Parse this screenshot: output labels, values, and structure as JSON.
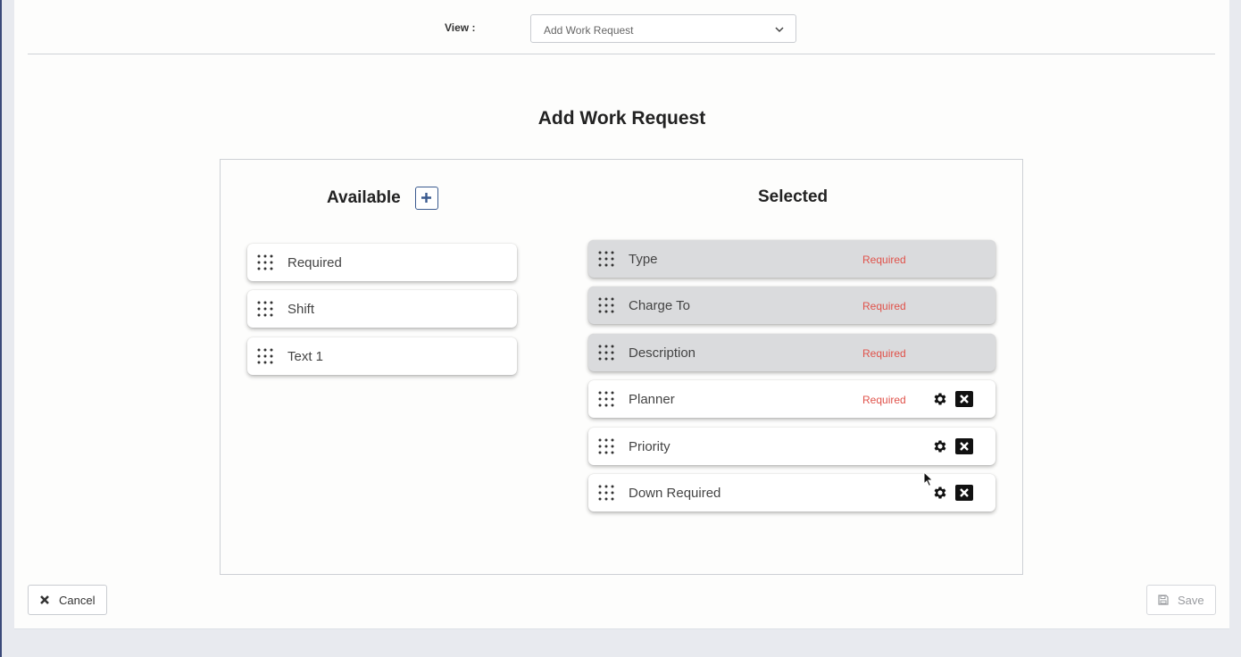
{
  "header": {
    "view_label": "View :",
    "view_select": {
      "value": "Add Work Request",
      "icon": "chevron-down-icon"
    }
  },
  "main": {
    "title": "Add Work Request",
    "available": {
      "title": "Available",
      "add_icon": "plus-icon",
      "items": [
        {
          "label": "Required"
        },
        {
          "label": "Shift"
        },
        {
          "label": "Text 1"
        }
      ]
    },
    "selected": {
      "title": "Selected",
      "items": [
        {
          "label": "Type",
          "tag": "Required",
          "locked": true
        },
        {
          "label": "Charge To",
          "tag": "Required",
          "locked": true
        },
        {
          "label": "Description",
          "tag": "Required",
          "locked": true
        },
        {
          "label": "Planner",
          "tag": "Required",
          "locked": false
        },
        {
          "label": "Priority",
          "tag": "",
          "locked": false
        },
        {
          "label": "Down Required",
          "tag": "",
          "locked": false
        }
      ]
    }
  },
  "footer": {
    "cancel_label": "Cancel",
    "save_label": "Save"
  },
  "colors": {
    "required_text": "#e0524a",
    "accent": "#3a5a8f",
    "locked_row": "#dadbdd"
  }
}
